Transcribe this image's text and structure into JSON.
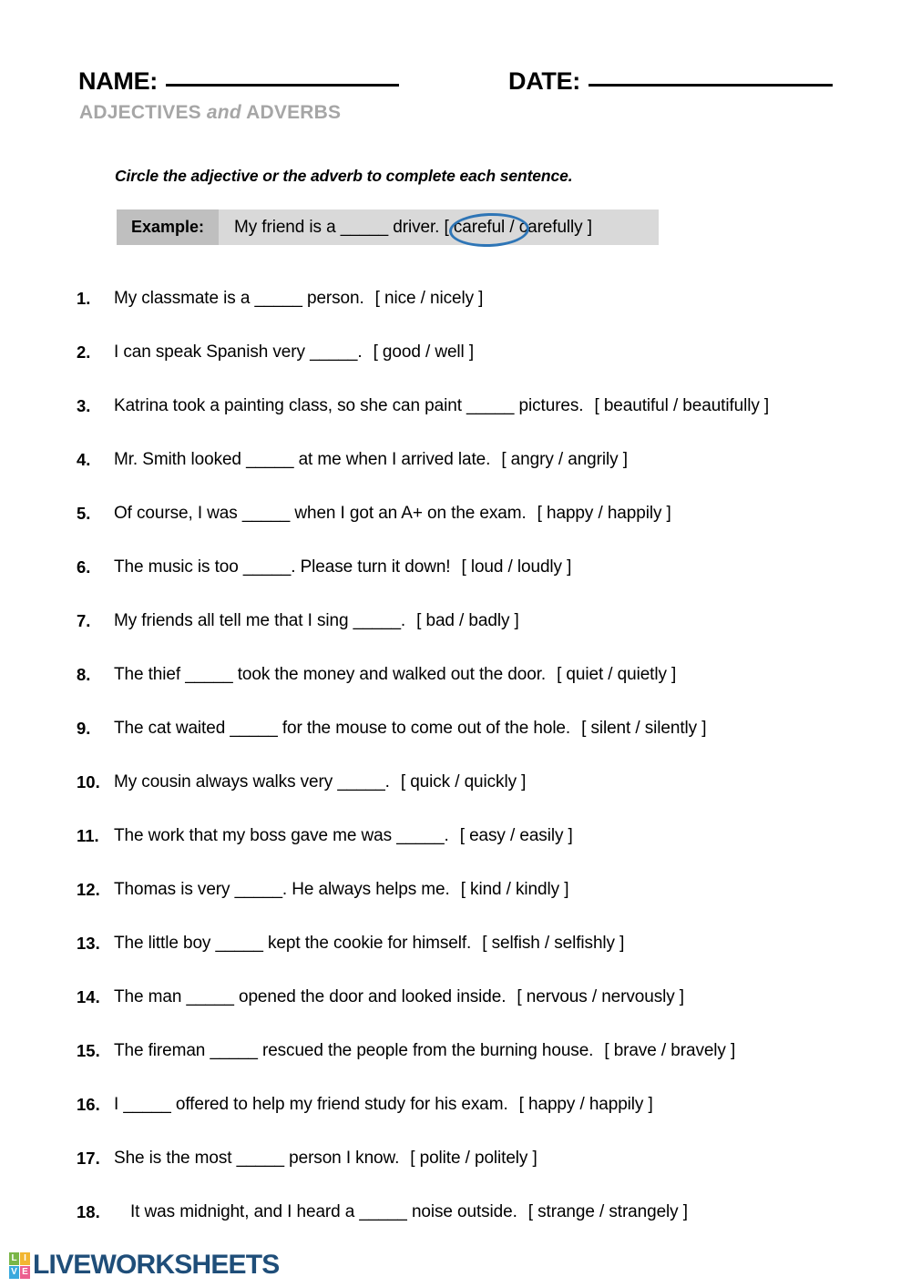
{
  "header": {
    "name_label": "NAME:",
    "date_label": "DATE:",
    "subtitle_part1": "ADJECTIVES",
    "subtitle_conjunction": "and",
    "subtitle_part2": "ADVERBS"
  },
  "instruction": "Circle the adjective or the adverb to complete each sentence.",
  "example": {
    "label": "Example:",
    "sentence": "My friend is a _____  driver.   [ careful / carefully ]",
    "circled_answer": "careful",
    "circle_color": "#2e75b6"
  },
  "questions": [
    {
      "number": "1.",
      "sentence": "My classmate is a _____ person.",
      "choices": "[ nice / nicely ]"
    },
    {
      "number": "2.",
      "sentence": "I can speak Spanish very _____.",
      "choices": "[ good / well ]"
    },
    {
      "number": "3.",
      "sentence": "Katrina took a painting class, so she can paint _____ pictures.",
      "choices": "[ beautiful / beautifully ]"
    },
    {
      "number": "4.",
      "sentence": "Mr. Smith looked _____ at me when I arrived late.",
      "choices": "[ angry / angrily ]"
    },
    {
      "number": "5.",
      "sentence": "Of course, I was _____ when I got an A+ on the exam.",
      "choices": "[ happy / happily ]"
    },
    {
      "number": "6.",
      "sentence": "The music is too _____.  Please turn it down!",
      "choices": "[ loud / loudly ]"
    },
    {
      "number": "7.",
      "sentence": "My friends all tell me that I sing _____.",
      "choices": "[ bad / badly ]"
    },
    {
      "number": "8.",
      "sentence": "The thief _____ took the money and walked out the door.",
      "choices": "[ quiet / quietly ]"
    },
    {
      "number": "9.",
      "sentence": "The cat waited _____ for the mouse to come out of the hole.",
      "choices": "[ silent / silently ]"
    },
    {
      "number": "10.",
      "sentence": "My cousin always walks very _____.",
      "choices": "[ quick / quickly ]"
    },
    {
      "number": "11.",
      "sentence": "The work that my boss gave me was _____.",
      "choices": "[ easy / easily ]"
    },
    {
      "number": "12.",
      "sentence": "Thomas is very _____.  He always helps me.",
      "choices": "[ kind / kindly ]"
    },
    {
      "number": "13.",
      "sentence": "The little boy _____ kept the cookie for himself.",
      "choices": "[ selfish / selfishly ]"
    },
    {
      "number": "14.",
      "sentence": "The man _____ opened the door and looked inside.",
      "choices": "[ nervous / nervously ]"
    },
    {
      "number": "15.",
      "sentence": "The fireman _____ rescued the people from the burning house.",
      "choices": "[ brave / bravely ]"
    },
    {
      "number": "16.",
      "sentence": "I _____ offered to help my friend study for his exam.",
      "choices": "[ happy / happily ]"
    },
    {
      "number": "17.",
      "sentence": "She is the most _____ person I know.",
      "choices": "[ polite / politely ]"
    },
    {
      "number": "18.",
      "sentence": "It was midnight, and I heard a _____ noise outside.",
      "choices": "[ strange / strangely ]",
      "indented": true
    }
  ],
  "footer": {
    "logo_tiles": [
      {
        "letter": "L",
        "color": "#7ab648"
      },
      {
        "letter": "I",
        "color": "#f2b632"
      },
      {
        "letter": "V",
        "color": "#3aa9dd"
      },
      {
        "letter": "E",
        "color": "#ec5f8f"
      }
    ],
    "wordmark": "LIVEWORKSHEETS",
    "wordmark_color": "#1f4e79"
  }
}
